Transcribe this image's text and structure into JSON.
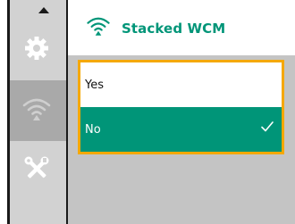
{
  "header": {
    "title": "Stacked WCM",
    "icon": "wireless-icon"
  },
  "sidebar": {
    "items": [
      {
        "icon": "arrow-up-icon"
      },
      {
        "icon": "gear-icon"
      },
      {
        "icon": "wireless-icon",
        "active": true
      },
      {
        "icon": "tools-icon"
      }
    ]
  },
  "options": [
    {
      "label": "Yes",
      "selected": false
    },
    {
      "label": "No",
      "selected": true
    }
  ],
  "colors": {
    "accent": "#009578",
    "focus_border": "#f5a800",
    "content_bg": "#c4c4c4",
    "sidebar_bg": "#d2d2d2",
    "sidebar_active_bg": "#a9a9a9"
  }
}
